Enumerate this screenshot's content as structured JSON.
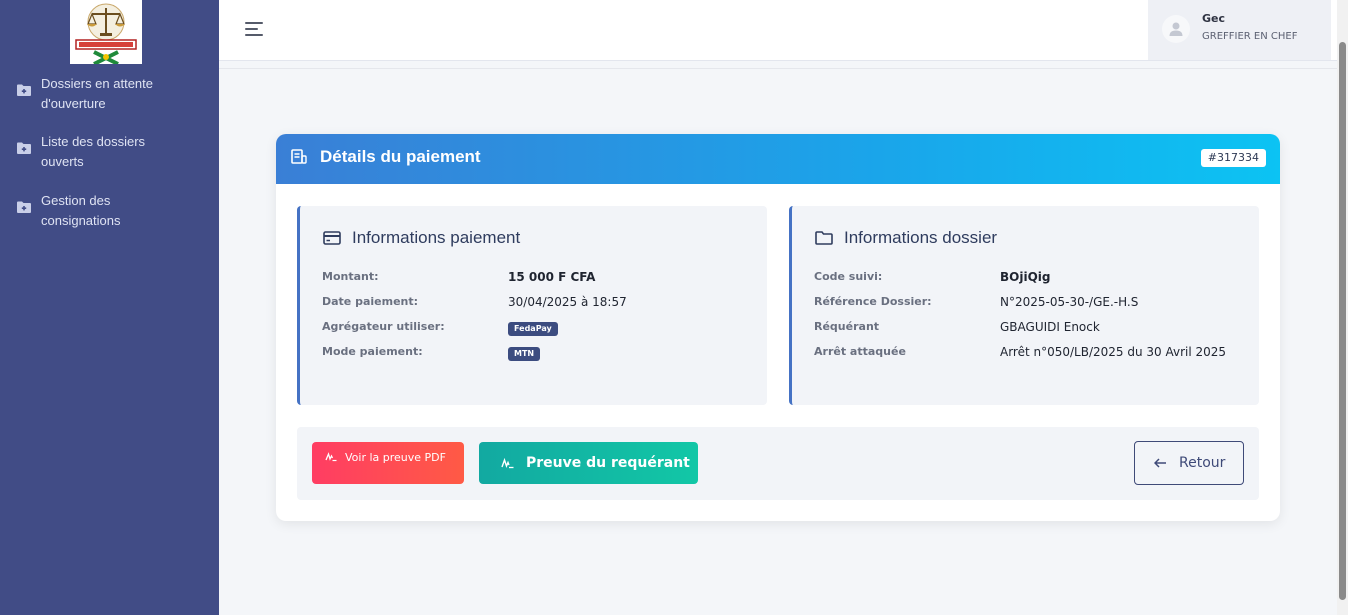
{
  "sidebar": {
    "items": [
      {
        "label": "Dossiers en attente d'ouverture"
      },
      {
        "label": "Liste des dossiers ouverts"
      },
      {
        "label": "Gestion des consignations"
      }
    ]
  },
  "user": {
    "name": "Gec",
    "role": "GREFFIER EN CHEF"
  },
  "card": {
    "title": "Détails du paiement",
    "id_badge": "#317334"
  },
  "payment_panel": {
    "title": "Informations paiement",
    "rows": [
      {
        "label": "Montant:",
        "value": "15 000 F CFA"
      },
      {
        "label": "Date paiement:",
        "value": "30/04/2025 à 18:57"
      },
      {
        "label": "Agrégateur utiliser:",
        "value": "FedaPay"
      },
      {
        "label": "Mode paiement:",
        "value": "MTN"
      }
    ]
  },
  "dossier_panel": {
    "title": "Informations dossier",
    "rows": [
      {
        "label": "Code suivi:",
        "value": "BOjiQig"
      },
      {
        "label": "Référence Dossier:",
        "value": "N°2025-05-30-/GE.-H.S"
      },
      {
        "label": "Réquérant",
        "value": "GBAGUIDI Enock"
      },
      {
        "label": "Arrêt attaquée",
        "value": "Arrêt n°050/LB/2025 du 30 Avril 2025"
      }
    ]
  },
  "actions": {
    "pdf_label": "Voir la preuve PDF",
    "requerant_label": "Preuve du requérant",
    "back_label": "Retour"
  },
  "colors": {
    "sidebar": "#414c86",
    "header_start": "#3a7fd6",
    "header_end": "#0cc3f3",
    "pdf_button": "#ff3d63",
    "requerant_button": "#12b8a4",
    "panel_accent": "#4572c4"
  }
}
